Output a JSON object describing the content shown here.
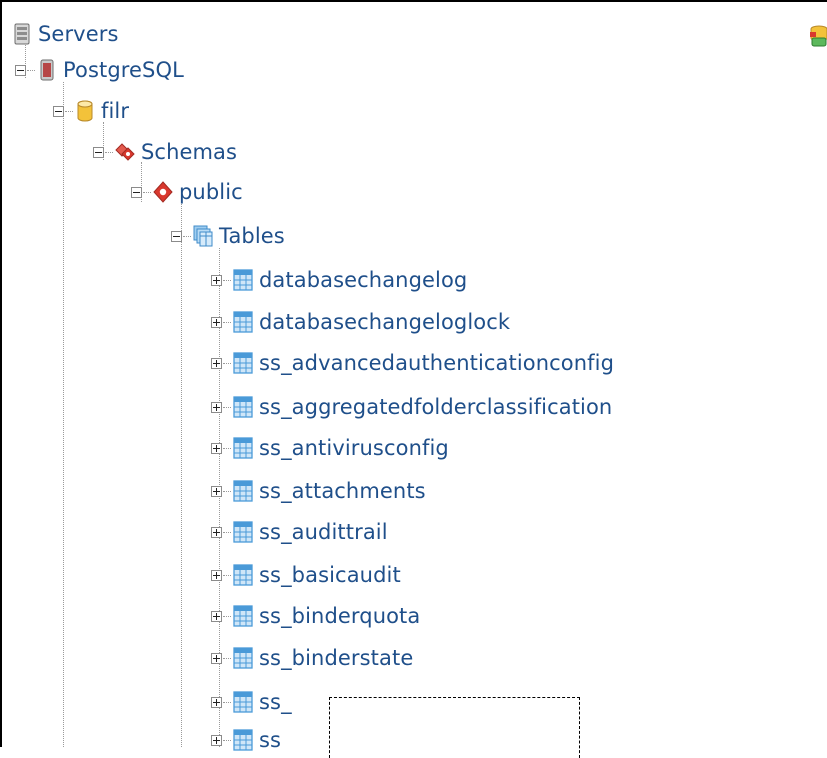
{
  "tree": {
    "servers": "Servers",
    "server": "PostgreSQL",
    "database": "filr",
    "schemas": "Schemas",
    "schema": "public",
    "tables": "Tables",
    "table_items": [
      "databasechangelog",
      "databasechangeloglock",
      "ss_advancedauthenticationconfig",
      "ss_aggregatedfolderclassification",
      "ss_antivirusconfig",
      "ss_attachments",
      "ss_audittrail",
      "ss_basicaudit",
      "ss_binderquota",
      "ss_binderstate",
      "ss_",
      "ss"
    ]
  },
  "icons": {
    "servers": "servers-icon",
    "server": "postgres-server-icon",
    "database": "database-icon",
    "schemas": "schemas-icon",
    "schema": "schema-icon",
    "tables": "tables-icon",
    "table": "table-icon",
    "corner": "connect-icon"
  },
  "colors": {
    "label": "#1f4f8a",
    "schema_red": "#d9382e",
    "db_yellow": "#f3c23a",
    "table_blue": "#4a9ad8"
  }
}
